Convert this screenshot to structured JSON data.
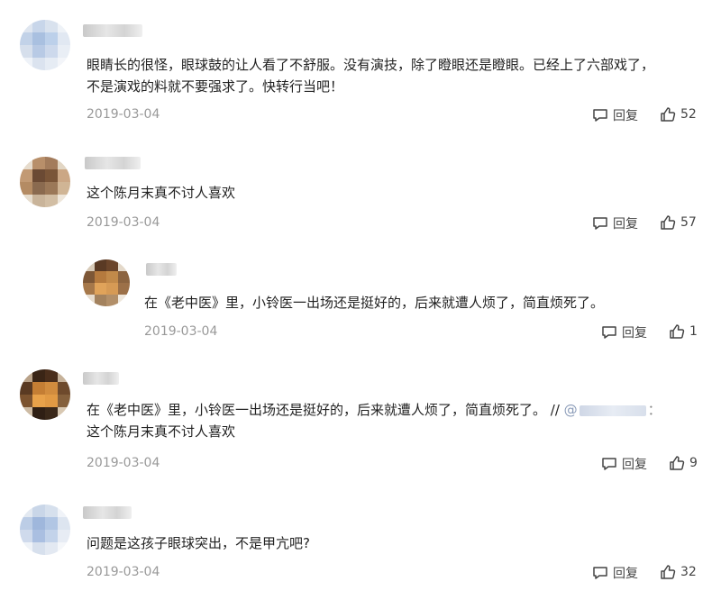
{
  "comments": [
    {
      "text_lines": [
        "眼睛长的很怪，眼球鼓的让人看了不舒服。没有演技，除了瞪眼还是瞪眼。已经上了六部戏了，",
        "不是演戏的料就不要强求了。快转行当吧！"
      ],
      "date": "2019-03-04",
      "reply_label": "回复",
      "likes": "52"
    },
    {
      "text_lines": [
        "这个陈月末真不讨人喜欢"
      ],
      "date": "2019-03-04",
      "reply_label": "回复",
      "likes": "57"
    },
    {
      "text_lines": [
        "在《老中医》里，小铃医一出场还是挺好的，后来就遭人烦了，简直烦死了。"
      ],
      "date": "2019-03-04",
      "reply_label": "回复",
      "likes": "1"
    },
    {
      "text_line1": "在《老中医》里，小铃医一出场还是挺好的，后来就遭人烦了，简直烦死了。 //",
      "mention_prefix": "@",
      "mention_suffix": "：",
      "text_line2": "这个陈月末真不讨人喜欢",
      "date": "2019-03-04",
      "reply_label": "回复",
      "likes": "9"
    },
    {
      "text_lines": [
        "问题是这孩子眼球突出，不是甲亢吧?"
      ],
      "date": "2019-03-04",
      "reply_label": "回复",
      "likes": "32"
    }
  ],
  "colors": {
    "text": "#222222",
    "meta": "#999999",
    "action": "#444444"
  },
  "icons": {
    "reply": "comment-bubble-icon",
    "like": "thumbs-up-icon"
  }
}
